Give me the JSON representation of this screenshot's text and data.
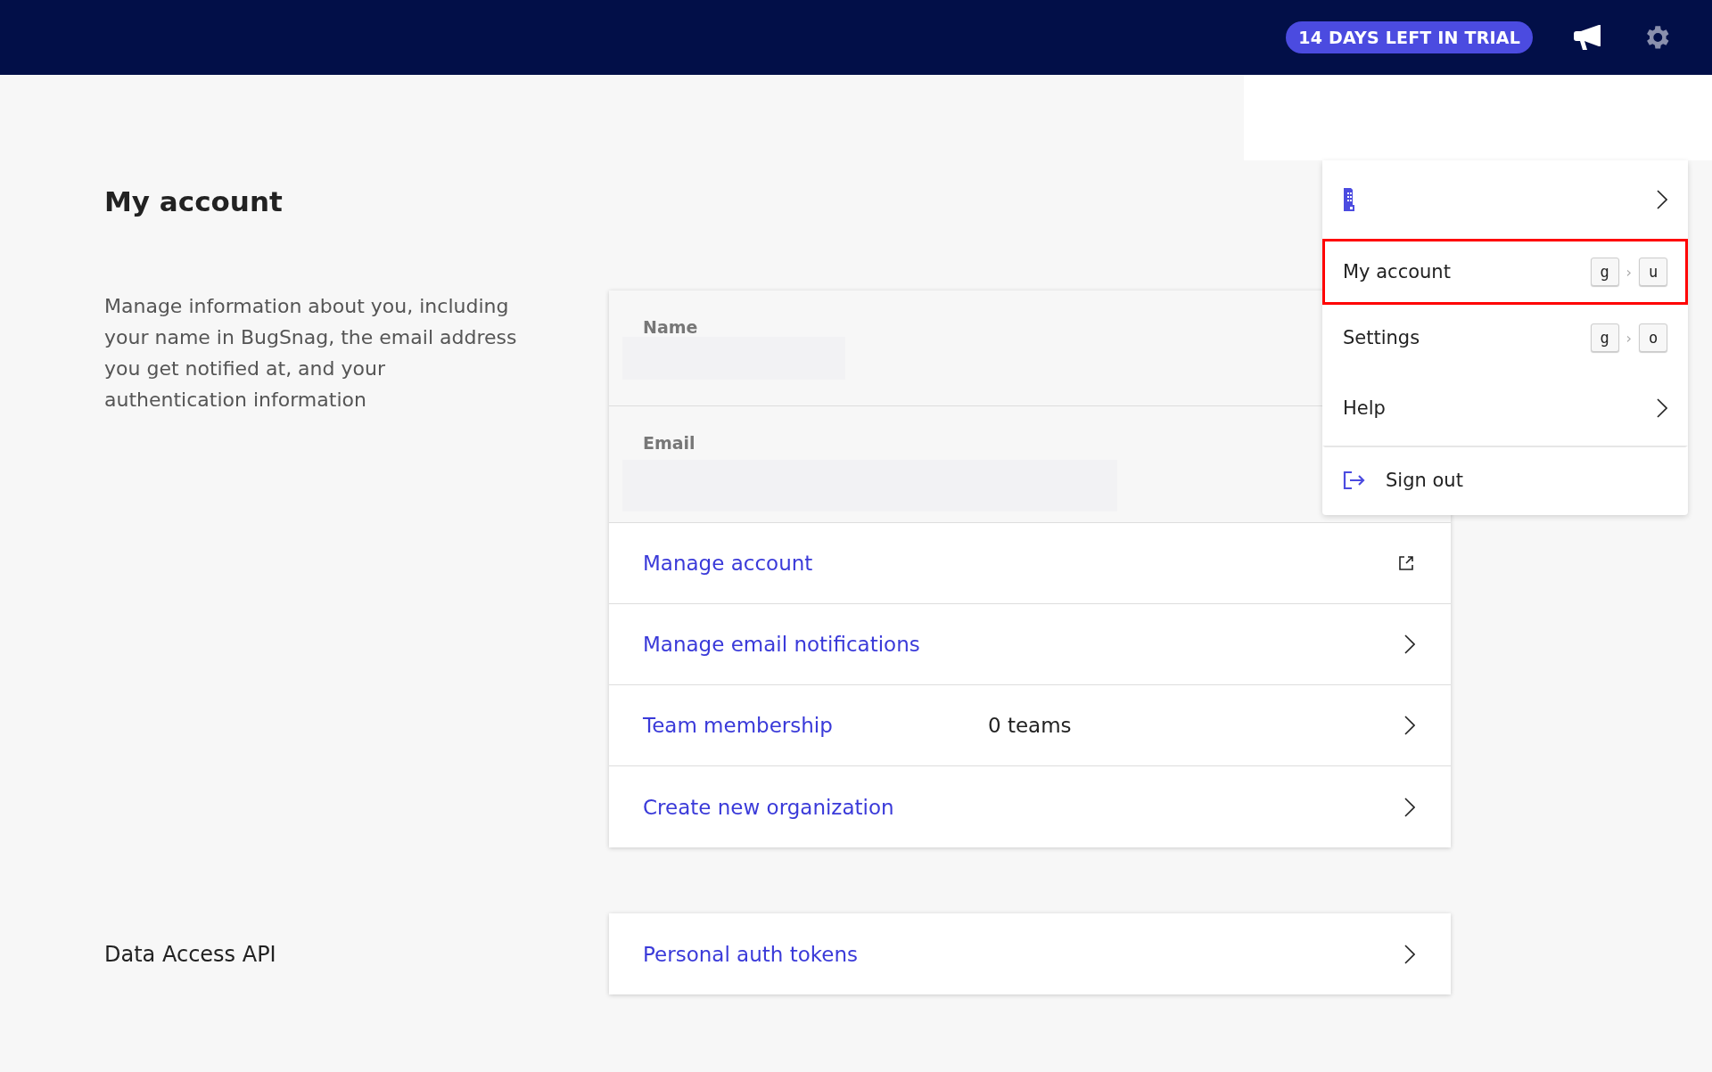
{
  "header": {
    "trial_badge": "14 DAYS LEFT IN TRIAL"
  },
  "account": {
    "title": "My account",
    "description": "Manage information about you, including your name in BugSnag, the email address you get notified at, and your authentication information",
    "fields": [
      {
        "label": "Name",
        "redacted": true
      },
      {
        "label": "Email",
        "redacted": true
      }
    ],
    "links": [
      {
        "label": "Manage account",
        "kind": "external"
      },
      {
        "label": "Manage email notifications",
        "kind": "chevron"
      },
      {
        "label": "Team membership",
        "value": "0 teams",
        "kind": "chevron"
      },
      {
        "label": "Create new organization",
        "kind": "chevron"
      }
    ]
  },
  "data_access": {
    "heading": "Data Access API",
    "links": [
      {
        "label": "Personal auth tokens",
        "kind": "chevron"
      }
    ]
  },
  "user_menu": {
    "items": [
      {
        "kind": "organization",
        "highlighted": false
      },
      {
        "kind": "shortcut",
        "label": "My account",
        "keys": [
          "g",
          "u"
        ],
        "separator": "›",
        "highlighted": true
      },
      {
        "kind": "shortcut",
        "label": "Settings",
        "keys": [
          "g",
          "o"
        ],
        "separator": "›",
        "highlighted": false
      },
      {
        "kind": "submenu",
        "label": "Help",
        "highlighted": false
      },
      {
        "kind": "action",
        "label": "Sign out",
        "highlighted": false
      }
    ]
  }
}
